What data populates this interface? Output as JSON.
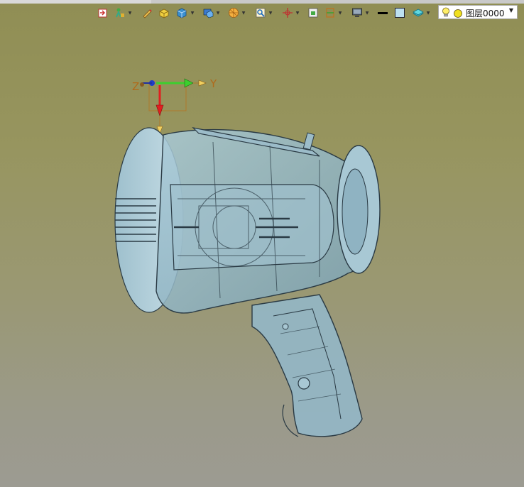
{
  "toolbar": {
    "icons": [
      "import-icon",
      "sketch-tool-icon",
      "pencil-icon",
      "box-icon",
      "solid-icon",
      "display-mode-icon",
      "render-style-icon",
      "zoom-window-icon",
      "crosshair-icon",
      "view-icon",
      "section-view-icon",
      "monitor-icon",
      "line-color-icon",
      "fill-color-icon",
      "layer-color-icon"
    ],
    "layer": {
      "label": "图层0000",
      "bulb_color": "#ffef6b",
      "dot_color": "#f0e020"
    }
  },
  "triad": {
    "x_label": "Z",
    "y_label": "Y",
    "colors": {
      "red": "#e02020",
      "green": "#3ccf2e",
      "blue": "#1f3cc8",
      "orange": "#c0702a"
    }
  },
  "model": {
    "name": "spotlight-model",
    "body_color": "#8fb3c2",
    "edge_color": "#2a3a44"
  }
}
